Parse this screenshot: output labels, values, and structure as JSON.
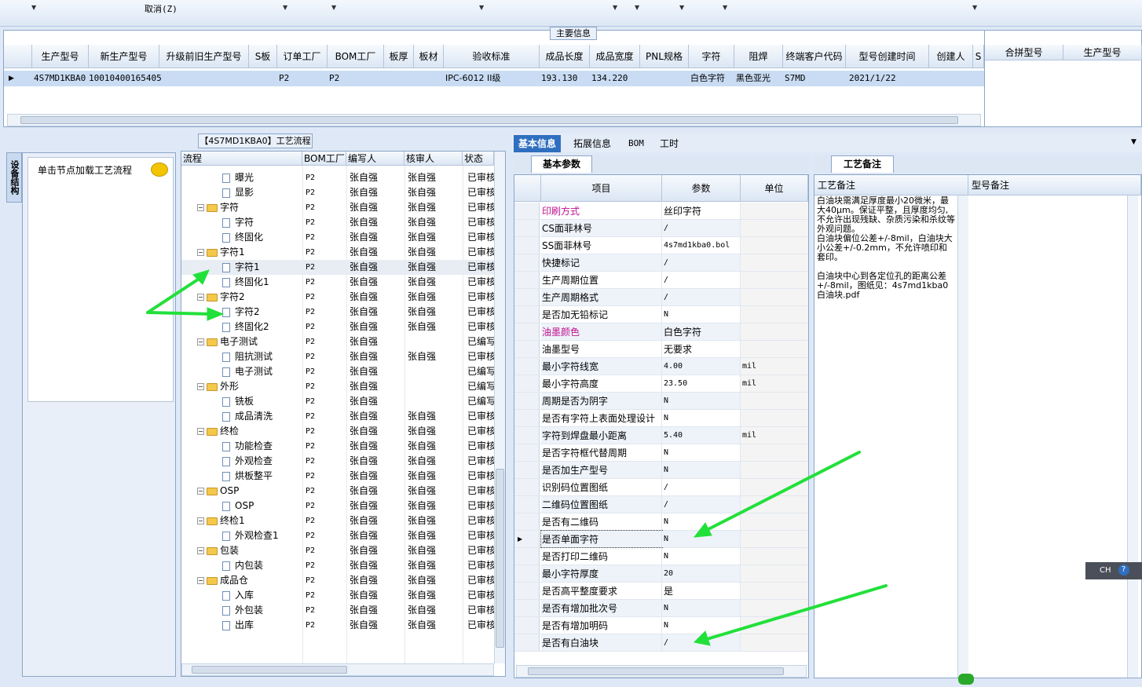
{
  "toolbar": {
    "cancel_label": "取消(Z)"
  },
  "main_info": {
    "legend": "主要信息",
    "columns": [
      "生产型号",
      "新生产型号",
      "升级前旧生产型号",
      "S板",
      "订单工厂",
      "BOM工厂",
      "板厚",
      "板材",
      "验收标准",
      "成品长度",
      "成品宽度",
      "PNL规格",
      "字符",
      "阻焊",
      "终端客户代码",
      "型号创建时间",
      "创建人",
      "S"
    ],
    "side_columns": [
      "合拼型号",
      "生产型号"
    ],
    "row": {
      "model": "4S7MD1KBA0",
      "new_model": "10010400165405",
      "order_factory": "P2",
      "bom_factory": "P2",
      "standard": "IPC-6012 II级",
      "length": "193.130",
      "width": "134.220",
      "char": "白色字符",
      "mask": "黑色亚光",
      "customer": "S7MD",
      "created": "2021/1/22"
    }
  },
  "left_panel": {
    "tab": "设备结构",
    "hint": "单击节点加载工艺流程"
  },
  "tree": {
    "title": "【4S7MD1KBA0】工艺流程",
    "columns": [
      "流程",
      "BOM工厂",
      "编写人",
      "核审人",
      "状态"
    ],
    "rows": [
      {
        "name": "曝光",
        "level": 2,
        "folder": false,
        "factory": "P2",
        "writer": "张自强",
        "reviewer": "张自强",
        "status": "已审核"
      },
      {
        "name": "显影",
        "level": 2,
        "folder": false,
        "factory": "P2",
        "writer": "张自强",
        "reviewer": "张自强",
        "status": "已审核"
      },
      {
        "name": "字符",
        "level": 1,
        "folder": true,
        "factory": "P2",
        "writer": "张自强",
        "reviewer": "张自强",
        "status": "已审核"
      },
      {
        "name": "字符",
        "level": 2,
        "folder": false,
        "factory": "P2",
        "writer": "张自强",
        "reviewer": "张自强",
        "status": "已审核"
      },
      {
        "name": "终固化",
        "level": 2,
        "folder": false,
        "factory": "P2",
        "writer": "张自强",
        "reviewer": "张自强",
        "status": "已审核"
      },
      {
        "name": "字符1",
        "level": 1,
        "folder": true,
        "factory": "P2",
        "writer": "张自强",
        "reviewer": "张自强",
        "status": "已审核"
      },
      {
        "name": "字符1",
        "level": 2,
        "folder": false,
        "factory": "P2",
        "writer": "张自强",
        "reviewer": "张自强",
        "status": "已审核"
      },
      {
        "name": "终固化1",
        "level": 2,
        "folder": false,
        "factory": "P2",
        "writer": "张自强",
        "reviewer": "张自强",
        "status": "已审核"
      },
      {
        "name": "字符2",
        "level": 1,
        "folder": true,
        "factory": "P2",
        "writer": "张自强",
        "reviewer": "张自强",
        "status": "已审核"
      },
      {
        "name": "字符2",
        "level": 2,
        "folder": false,
        "factory": "P2",
        "writer": "张自强",
        "reviewer": "张自强",
        "status": "已审核"
      },
      {
        "name": "终固化2",
        "level": 2,
        "folder": false,
        "factory": "P2",
        "writer": "张自强",
        "reviewer": "张自强",
        "status": "已审核"
      },
      {
        "name": "电子测试",
        "level": 1,
        "folder": true,
        "factory": "P2",
        "writer": "张自强",
        "reviewer": "",
        "status": "已编写"
      },
      {
        "name": "阻抗测试",
        "level": 2,
        "folder": false,
        "factory": "P2",
        "writer": "张自强",
        "reviewer": "张自强",
        "status": "已审核"
      },
      {
        "name": "电子测试",
        "level": 2,
        "folder": false,
        "factory": "P2",
        "writer": "张自强",
        "reviewer": "",
        "status": "已编写"
      },
      {
        "name": "外形",
        "level": 1,
        "folder": true,
        "factory": "P2",
        "writer": "张自强",
        "reviewer": "",
        "status": "已编写"
      },
      {
        "name": "铣板",
        "level": 2,
        "folder": false,
        "factory": "P2",
        "writer": "张自强",
        "reviewer": "",
        "status": "已编写"
      },
      {
        "name": "成品清洗",
        "level": 2,
        "folder": false,
        "factory": "P2",
        "writer": "张自强",
        "reviewer": "张自强",
        "status": "已审核"
      },
      {
        "name": "终检",
        "level": 1,
        "folder": true,
        "factory": "P2",
        "writer": "张自强",
        "reviewer": "张自强",
        "status": "已审核"
      },
      {
        "name": "功能检查",
        "level": 2,
        "folder": false,
        "factory": "P2",
        "writer": "张自强",
        "reviewer": "张自强",
        "status": "已审核"
      },
      {
        "name": "外观检查",
        "level": 2,
        "folder": false,
        "factory": "P2",
        "writer": "张自强",
        "reviewer": "张自强",
        "status": "已审核"
      },
      {
        "name": "烘板整平",
        "level": 2,
        "folder": false,
        "factory": "P2",
        "writer": "张自强",
        "reviewer": "张自强",
        "status": "已审核"
      },
      {
        "name": "OSP",
        "level": 1,
        "folder": true,
        "factory": "P2",
        "writer": "张自强",
        "reviewer": "张自强",
        "status": "已审核"
      },
      {
        "name": "OSP",
        "level": 2,
        "folder": false,
        "factory": "P2",
        "writer": "张自强",
        "reviewer": "张自强",
        "status": "已审核"
      },
      {
        "name": "终检1",
        "level": 1,
        "folder": true,
        "factory": "P2",
        "writer": "张自强",
        "reviewer": "张自强",
        "status": "已审核"
      },
      {
        "name": "外观检查1",
        "level": 2,
        "folder": false,
        "factory": "P2",
        "writer": "张自强",
        "reviewer": "张自强",
        "status": "已审核"
      },
      {
        "name": "包装",
        "level": 1,
        "folder": true,
        "factory": "P2",
        "writer": "张自强",
        "reviewer": "张自强",
        "status": "已审核"
      },
      {
        "name": "内包装",
        "level": 2,
        "folder": false,
        "factory": "P2",
        "writer": "张自强",
        "reviewer": "张自强",
        "status": "已审核"
      },
      {
        "name": "成品仓",
        "level": 1,
        "folder": true,
        "factory": "P2",
        "writer": "张自强",
        "reviewer": "张自强",
        "status": "已审核"
      },
      {
        "name": "入库",
        "level": 2,
        "folder": false,
        "factory": "P2",
        "writer": "张自强",
        "reviewer": "张自强",
        "status": "已审核"
      },
      {
        "name": "外包装",
        "level": 2,
        "folder": false,
        "factory": "P2",
        "writer": "张自强",
        "reviewer": "张自强",
        "status": "已审核"
      },
      {
        "name": "出库",
        "level": 2,
        "folder": false,
        "factory": "P2",
        "writer": "张自强",
        "reviewer": "张自强",
        "status": "已审核"
      }
    ]
  },
  "tabs": [
    "基本信息",
    "拓展信息",
    "BOM",
    "工时"
  ],
  "params": {
    "tab": "基本参数",
    "columns": [
      "项目",
      "参数",
      "单位"
    ],
    "rows": [
      {
        "item": "印刷方式",
        "value": "丝印字符",
        "unit": "",
        "hl": true
      },
      {
        "item": "CS面菲林号",
        "value": "/",
        "unit": ""
      },
      {
        "item": "SS面菲林号",
        "value": "4s7md1kba0.bol",
        "unit": ""
      },
      {
        "item": "快捷标记",
        "value": "/",
        "unit": ""
      },
      {
        "item": "生产周期位置",
        "value": "/",
        "unit": ""
      },
      {
        "item": "生产周期格式",
        "value": "/",
        "unit": ""
      },
      {
        "item": "是否加无铅标记",
        "value": "N",
        "unit": ""
      },
      {
        "item": "油墨颜色",
        "value": "白色字符",
        "unit": "",
        "hl": true
      },
      {
        "item": "油墨型号",
        "value": "无要求",
        "unit": ""
      },
      {
        "item": "最小字符线宽",
        "value": "4.00",
        "unit": "mil"
      },
      {
        "item": "最小字符高度",
        "value": "23.50",
        "unit": "mil"
      },
      {
        "item": "周期是否为阴字",
        "value": "N",
        "unit": ""
      },
      {
        "item": "是否有字符上表面处理设计",
        "value": "N",
        "unit": ""
      },
      {
        "item": "字符到焊盘最小距离",
        "value": "5.40",
        "unit": "mil"
      },
      {
        "item": "是否字符框代替周期",
        "value": "N",
        "unit": ""
      },
      {
        "item": "是否加生产型号",
        "value": "N",
        "unit": ""
      },
      {
        "item": "识别码位置图纸",
        "value": "/",
        "unit": ""
      },
      {
        "item": "二维码位置图纸",
        "value": "/",
        "unit": ""
      },
      {
        "item": "是否有二维码",
        "value": "N",
        "unit": ""
      },
      {
        "item": "是否单面字符",
        "value": "N",
        "unit": "",
        "selected": true
      },
      {
        "item": "是否打印二维码",
        "value": "N",
        "unit": ""
      },
      {
        "item": "最小字符厚度",
        "value": "20",
        "unit": ""
      },
      {
        "item": "是否高平整度要求",
        "value": "是",
        "unit": ""
      },
      {
        "item": "是否有增加批次号",
        "value": "N",
        "unit": ""
      },
      {
        "item": "是否有增加明码",
        "value": "N",
        "unit": ""
      },
      {
        "item": "是否有白油块",
        "value": "/",
        "unit": ""
      }
    ]
  },
  "notes": {
    "tab": "工艺备注",
    "col1": "工艺备注",
    "col2": "型号备注",
    "text": "白油块需满足厚度最小20微米，最大40μm。保证平整，且厚度均匀,不允许出现残缺、杂质污染和杀纹等外观问题。\n白油块偏位公差+/-8mil，白油块大小公差+/-0.2mm，不允许喷印和套印。\n\n白油块中心到各定位孔的距离公差+/-8mil，图纸见：4s7md1kba0白油块.pdf"
  },
  "ime": {
    "label": "CH"
  },
  "colors": {
    "accent": "#2f6fbf",
    "selection": "#c9dcf3",
    "arrow": "#22e03a"
  }
}
